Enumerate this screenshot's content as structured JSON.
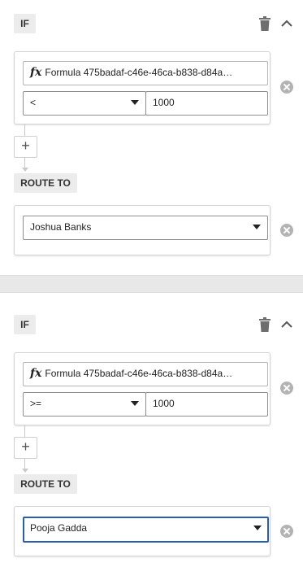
{
  "rules": [
    {
      "if_label": "IF",
      "formula_prefix": "fx",
      "formula_text": "Formula 475badaf-c46e-46ca-b838-d84a…",
      "operator": "<",
      "value": "1000",
      "add_label": "+",
      "route_label": "ROUTE TO",
      "route_value": "Joshua Banks"
    },
    {
      "if_label": "IF",
      "formula_prefix": "fx",
      "formula_text": "Formula 475badaf-c46e-46ca-b838-d84a…",
      "operator": ">=",
      "value": "1000",
      "add_label": "+",
      "route_label": "ROUTE TO",
      "route_value": "Pooja Gadda"
    }
  ],
  "icons": {
    "delete": "trash-icon",
    "collapse": "chevron-up-icon",
    "remove": "close-circle-icon",
    "add": "plus-icon"
  },
  "colors": {
    "focus_border": "#2a5db0",
    "label_bg": "#ececec",
    "icon_gray": "#b3b3b3"
  }
}
